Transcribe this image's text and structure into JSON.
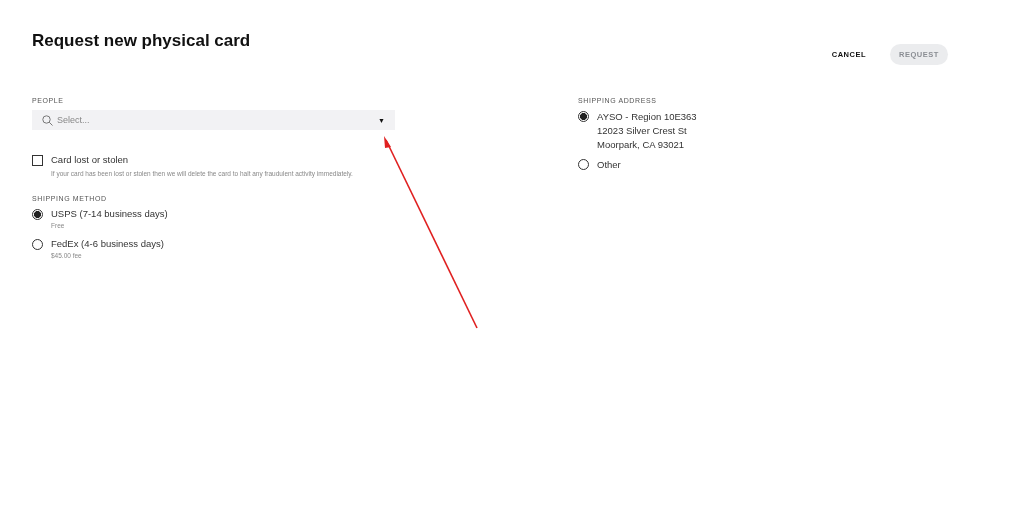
{
  "title": "Request new physical card",
  "actions": {
    "cancel": {
      "label": "CANCEL",
      "disabled": false
    },
    "request": {
      "label": "REQUEST",
      "disabled": true
    }
  },
  "people": {
    "label": "PEOPLE",
    "placeholder": "Select...",
    "caret": "▼"
  },
  "lost_card": {
    "label": "Card lost or stolen",
    "checked": false,
    "hint": "If your card has been lost or stolen then we will delete the card to halt any fraudulent activity immediately."
  },
  "shipping_method": {
    "label": "SHIPPING METHOD",
    "options": [
      {
        "label": "USPS (7-14 business days)",
        "note": "Free",
        "selected": true
      },
      {
        "label": "FedEx (4-6 business days)",
        "note": "$45.00 fee",
        "selected": false
      }
    ]
  },
  "shipping_address": {
    "label": "SHIPPING ADDRESS",
    "options": [
      {
        "lines": [
          "AYSO - Region 10E363",
          "12023 Silver Crest St",
          "Moorpark, CA 93021"
        ],
        "selected": true
      },
      {
        "lines": [
          "Other"
        ],
        "selected": false
      }
    ]
  },
  "annotation": {
    "kind": "arrow"
  }
}
